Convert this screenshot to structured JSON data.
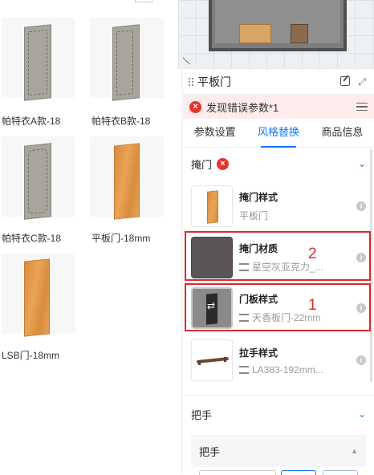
{
  "catalog": {
    "items": [
      {
        "label": "帕特衣A款-18",
        "style": "gray"
      },
      {
        "label": "帕特衣B款-18",
        "style": "gray"
      },
      {
        "label": "帕特衣C款-18",
        "style": "gray"
      },
      {
        "label": "平板门-18mm",
        "style": "wood"
      },
      {
        "label": "LSB门-18mm",
        "style": "wood"
      }
    ]
  },
  "panel": {
    "title": "平板门",
    "error_text": "发现错误参数*1",
    "tabs": [
      {
        "label": "参数设置",
        "active": false
      },
      {
        "label": "风格替换",
        "active": true
      },
      {
        "label": "商品信息",
        "active": false
      }
    ],
    "section_door": {
      "title": "掩门",
      "options": [
        {
          "name": "掩门样式",
          "value": "平板门"
        },
        {
          "name": "掩门材质",
          "value": "星空灰亚克力_..."
        },
        {
          "name": "门板样式",
          "value": "天香板门-22mm"
        },
        {
          "name": "拉手样式",
          "value": "LA383-192mm..."
        }
      ]
    },
    "section_handle": {
      "title": "把手",
      "sub_title": "把手"
    }
  },
  "annotations": [
    "2",
    "1"
  ],
  "colors": {
    "accent": "#1677ff",
    "error": "#e9332f",
    "highlight": "#e0282e",
    "error_bg": "#fdecec"
  }
}
